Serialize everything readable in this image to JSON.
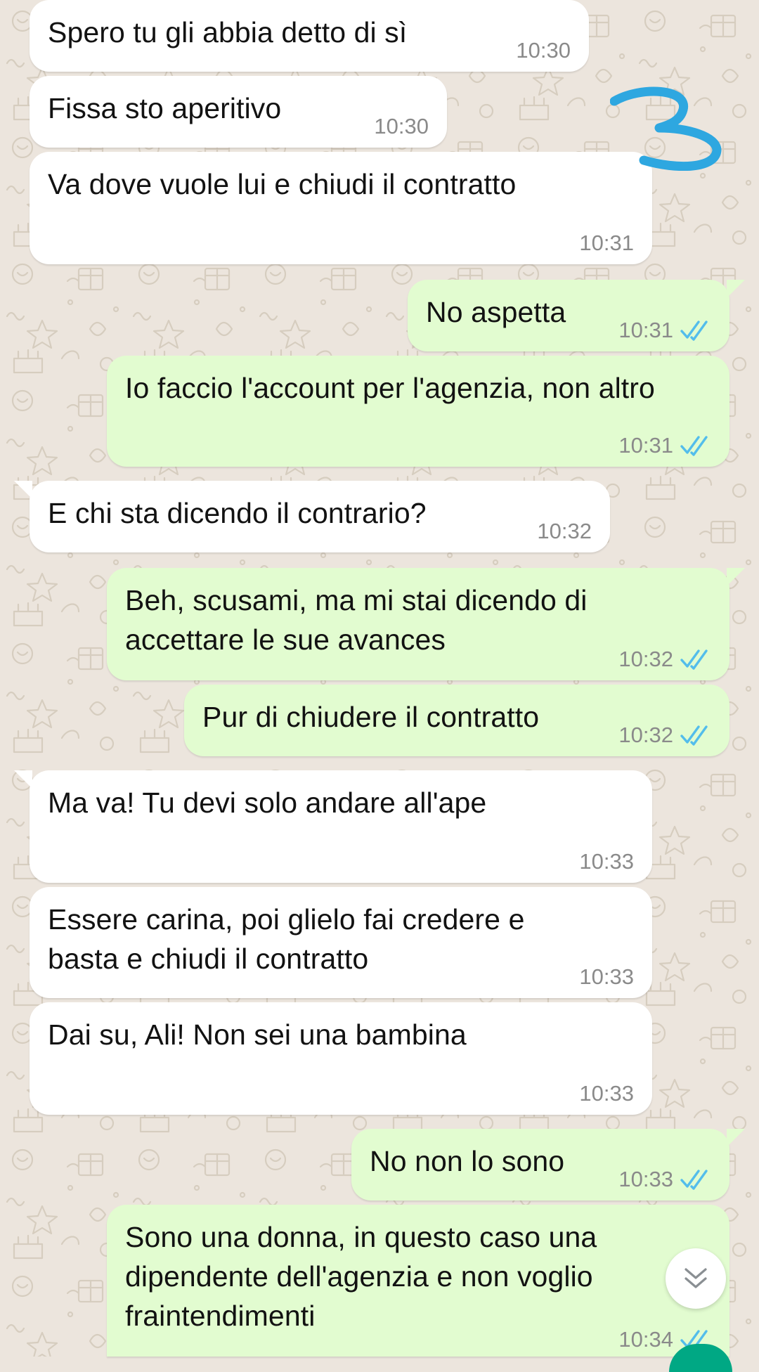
{
  "colors": {
    "incoming_bubble": "#ffffff",
    "outgoing_bubble": "#e2fcd0",
    "read_ticks": "#53bdeb",
    "annotation_stroke": "#2ea7e0",
    "wallpaper": "#ece5dd",
    "fab": "#00a884"
  },
  "annotation": {
    "icon": "handwritten-3-mark"
  },
  "scroll_button": {
    "icon": "double-chevron-down-icon"
  },
  "messages": [
    {
      "direction": "in",
      "text": "Spero tu gli abbia detto di sì",
      "time": "10:30"
    },
    {
      "direction": "in",
      "text": "Fissa sto aperitivo",
      "time": "10:30"
    },
    {
      "direction": "in",
      "text": "Va dove vuole lui e chiudi il contratto",
      "time": "10:31"
    },
    {
      "direction": "out",
      "text": "No aspetta",
      "time": "10:31",
      "status": "read"
    },
    {
      "direction": "out",
      "text": "Io faccio l'account per l'agenzia, non altro",
      "time": "10:31",
      "status": "read"
    },
    {
      "direction": "in",
      "text": "E chi sta dicendo il contrario?",
      "time": "10:32"
    },
    {
      "direction": "out",
      "text": "Beh, scusami, ma mi stai dicendo di accettare le sue avances",
      "time": "10:32",
      "status": "read"
    },
    {
      "direction": "out",
      "text": "Pur di chiudere il contratto",
      "time": "10:32",
      "status": "read"
    },
    {
      "direction": "in",
      "text": "Ma va! Tu devi solo andare all'ape",
      "time": "10:33"
    },
    {
      "direction": "in",
      "text": "Essere carina, poi glielo fai credere e basta e chiudi il contratto",
      "time": "10:33"
    },
    {
      "direction": "in",
      "text": "Dai su, Ali! Non sei una bambina",
      "time": "10:33"
    },
    {
      "direction": "out",
      "text": "No non lo sono",
      "time": "10:33",
      "status": "read"
    },
    {
      "direction": "out",
      "text": "Sono una donna, in questo caso una dipendente dell'agenzia e non voglio fraintendimenti",
      "time": "10:34",
      "status": "read"
    }
  ]
}
